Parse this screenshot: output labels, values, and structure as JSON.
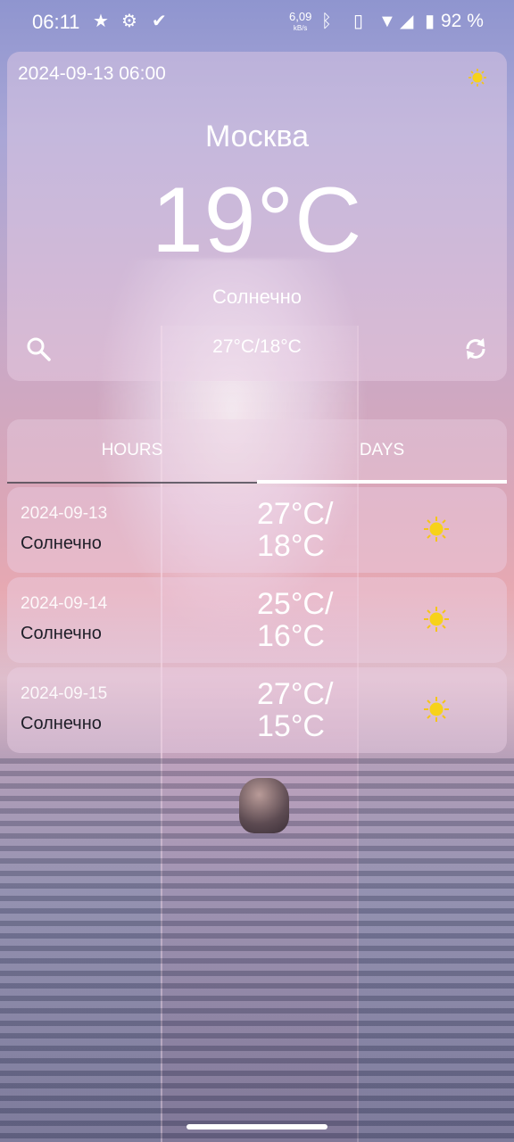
{
  "status_bar": {
    "time": "06:11",
    "icons": [
      "star-icon",
      "settings-icon",
      "check-icon",
      "bluetooth-icon",
      "vibrate-icon",
      "wifi-icon",
      "signal-icon",
      "battery-icon"
    ],
    "net_speed": "6,09",
    "net_unit": "kB/s",
    "battery": "92 %"
  },
  "current": {
    "datetime": "2024-09-13 06:00",
    "city": "Москва",
    "temperature": "19°C",
    "condition": "Солнечно",
    "range": "27°C/18°C"
  },
  "tabs": {
    "hours": "HOURS",
    "days": "DAYS",
    "selected": "days"
  },
  "forecast": [
    {
      "date": "2024-09-13",
      "condition": "Солнечно",
      "high": "27°C/",
      "low": "18°C",
      "icon": "sun-icon"
    },
    {
      "date": "2024-09-14",
      "condition": "Солнечно",
      "high": "25°C/",
      "low": "16°C",
      "icon": "sun-icon"
    },
    {
      "date": "2024-09-15",
      "condition": "Солнечно",
      "high": "27°C/",
      "low": "15°C",
      "icon": "sun-icon"
    }
  ],
  "colors": {
    "sun": "#f5c518",
    "accent_text": "#ffffff",
    "condition_text": "#1e1e28"
  }
}
